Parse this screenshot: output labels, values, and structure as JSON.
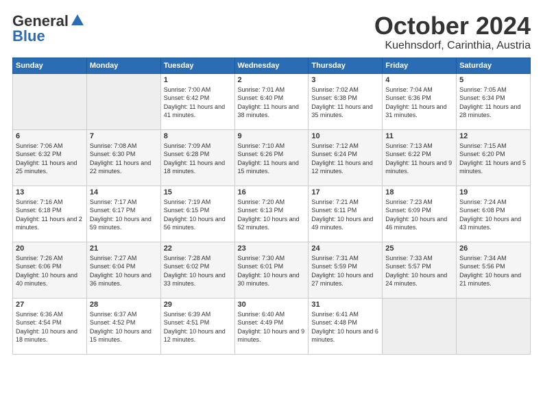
{
  "header": {
    "logo_general": "General",
    "logo_blue": "Blue",
    "title": "October 2024",
    "subtitle": "Kuehnsdorf, Carinthia, Austria"
  },
  "calendar": {
    "days_of_week": [
      "Sunday",
      "Monday",
      "Tuesday",
      "Wednesday",
      "Thursday",
      "Friday",
      "Saturday"
    ],
    "weeks": [
      [
        {
          "day": "",
          "info": ""
        },
        {
          "day": "",
          "info": ""
        },
        {
          "day": "1",
          "info": "Sunrise: 7:00 AM\nSunset: 6:42 PM\nDaylight: 11 hours and 41 minutes."
        },
        {
          "day": "2",
          "info": "Sunrise: 7:01 AM\nSunset: 6:40 PM\nDaylight: 11 hours and 38 minutes."
        },
        {
          "day": "3",
          "info": "Sunrise: 7:02 AM\nSunset: 6:38 PM\nDaylight: 11 hours and 35 minutes."
        },
        {
          "day": "4",
          "info": "Sunrise: 7:04 AM\nSunset: 6:36 PM\nDaylight: 11 hours and 31 minutes."
        },
        {
          "day": "5",
          "info": "Sunrise: 7:05 AM\nSunset: 6:34 PM\nDaylight: 11 hours and 28 minutes."
        }
      ],
      [
        {
          "day": "6",
          "info": "Sunrise: 7:06 AM\nSunset: 6:32 PM\nDaylight: 11 hours and 25 minutes."
        },
        {
          "day": "7",
          "info": "Sunrise: 7:08 AM\nSunset: 6:30 PM\nDaylight: 11 hours and 22 minutes."
        },
        {
          "day": "8",
          "info": "Sunrise: 7:09 AM\nSunset: 6:28 PM\nDaylight: 11 hours and 18 minutes."
        },
        {
          "day": "9",
          "info": "Sunrise: 7:10 AM\nSunset: 6:26 PM\nDaylight: 11 hours and 15 minutes."
        },
        {
          "day": "10",
          "info": "Sunrise: 7:12 AM\nSunset: 6:24 PM\nDaylight: 11 hours and 12 minutes."
        },
        {
          "day": "11",
          "info": "Sunrise: 7:13 AM\nSunset: 6:22 PM\nDaylight: 11 hours and 9 minutes."
        },
        {
          "day": "12",
          "info": "Sunrise: 7:15 AM\nSunset: 6:20 PM\nDaylight: 11 hours and 5 minutes."
        }
      ],
      [
        {
          "day": "13",
          "info": "Sunrise: 7:16 AM\nSunset: 6:18 PM\nDaylight: 11 hours and 2 minutes."
        },
        {
          "day": "14",
          "info": "Sunrise: 7:17 AM\nSunset: 6:17 PM\nDaylight: 10 hours and 59 minutes."
        },
        {
          "day": "15",
          "info": "Sunrise: 7:19 AM\nSunset: 6:15 PM\nDaylight: 10 hours and 56 minutes."
        },
        {
          "day": "16",
          "info": "Sunrise: 7:20 AM\nSunset: 6:13 PM\nDaylight: 10 hours and 52 minutes."
        },
        {
          "day": "17",
          "info": "Sunrise: 7:21 AM\nSunset: 6:11 PM\nDaylight: 10 hours and 49 minutes."
        },
        {
          "day": "18",
          "info": "Sunrise: 7:23 AM\nSunset: 6:09 PM\nDaylight: 10 hours and 46 minutes."
        },
        {
          "day": "19",
          "info": "Sunrise: 7:24 AM\nSunset: 6:08 PM\nDaylight: 10 hours and 43 minutes."
        }
      ],
      [
        {
          "day": "20",
          "info": "Sunrise: 7:26 AM\nSunset: 6:06 PM\nDaylight: 10 hours and 40 minutes."
        },
        {
          "day": "21",
          "info": "Sunrise: 7:27 AM\nSunset: 6:04 PM\nDaylight: 10 hours and 36 minutes."
        },
        {
          "day": "22",
          "info": "Sunrise: 7:28 AM\nSunset: 6:02 PM\nDaylight: 10 hours and 33 minutes."
        },
        {
          "day": "23",
          "info": "Sunrise: 7:30 AM\nSunset: 6:01 PM\nDaylight: 10 hours and 30 minutes."
        },
        {
          "day": "24",
          "info": "Sunrise: 7:31 AM\nSunset: 5:59 PM\nDaylight: 10 hours and 27 minutes."
        },
        {
          "day": "25",
          "info": "Sunrise: 7:33 AM\nSunset: 5:57 PM\nDaylight: 10 hours and 24 minutes."
        },
        {
          "day": "26",
          "info": "Sunrise: 7:34 AM\nSunset: 5:56 PM\nDaylight: 10 hours and 21 minutes."
        }
      ],
      [
        {
          "day": "27",
          "info": "Sunrise: 6:36 AM\nSunset: 4:54 PM\nDaylight: 10 hours and 18 minutes."
        },
        {
          "day": "28",
          "info": "Sunrise: 6:37 AM\nSunset: 4:52 PM\nDaylight: 10 hours and 15 minutes."
        },
        {
          "day": "29",
          "info": "Sunrise: 6:39 AM\nSunset: 4:51 PM\nDaylight: 10 hours and 12 minutes."
        },
        {
          "day": "30",
          "info": "Sunrise: 6:40 AM\nSunset: 4:49 PM\nDaylight: 10 hours and 9 minutes."
        },
        {
          "day": "31",
          "info": "Sunrise: 6:41 AM\nSunset: 4:48 PM\nDaylight: 10 hours and 6 minutes."
        },
        {
          "day": "",
          "info": ""
        },
        {
          "day": "",
          "info": ""
        }
      ]
    ]
  }
}
